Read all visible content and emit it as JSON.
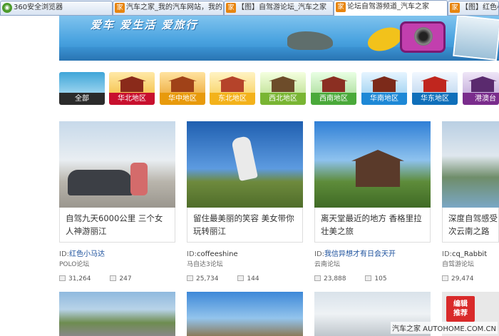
{
  "tabs": [
    {
      "label": "360安全浏览器",
      "active": false
    },
    {
      "label": "汽车之家_我的汽车网站，我的",
      "active": false
    },
    {
      "label": "【图】自驾游论坛_汽车之家",
      "active": false
    },
    {
      "label": "论坛自驾游频道_汽车之家",
      "active": true
    },
    {
      "label": "【图】红色小",
      "active": false
    }
  ],
  "banner": {
    "slogan": "爱车 爱生活 爱旅行"
  },
  "regions": [
    {
      "label": "全部",
      "color": "#2b2b2b"
    },
    {
      "label": "华北地区",
      "color": "#c8102e"
    },
    {
      "label": "华中地区",
      "color": "#e89a0c"
    },
    {
      "label": "东北地区",
      "color": "#f3b21b"
    },
    {
      "label": "西北地区",
      "color": "#79b533"
    },
    {
      "label": "西南地区",
      "color": "#4aa93a"
    },
    {
      "label": "华南地区",
      "color": "#1e88d6"
    },
    {
      "label": "华东地区",
      "color": "#0f6fba"
    },
    {
      "label": "港澳台",
      "color": "#7a2c8c"
    }
  ],
  "cards": [
    {
      "title": "自驾九天6000公里 三个女人神游丽江",
      "author_prefix": "ID:",
      "author": "红色小马达",
      "forum": "POLO论坛",
      "views": "31,264",
      "replies": "247"
    },
    {
      "title": "留住最美丽的笑容 美女带你玩转丽江",
      "author_prefix": "ID:",
      "author": "coffeeshine",
      "forum": "马自达3论坛",
      "views": "25,734",
      "replies": "144"
    },
    {
      "title": "离天堂最近的地方 香格里拉壮美之旅",
      "author_prefix": "ID:",
      "author": "我信异想才有日会天开",
      "forum": "云南论坛",
      "views": "23,888",
      "replies": "105"
    },
    {
      "title": "深度自驾感受 次云南之路",
      "author_prefix": "ID:",
      "author": "cq_Rabbit",
      "forum": "自驾游论坛",
      "views": "29,474",
      "replies": ""
    }
  ],
  "badge": {
    "line1": "编辑",
    "line2": "推荐"
  },
  "watermark": "汽车之家 AUTOHOME.COM.CN"
}
